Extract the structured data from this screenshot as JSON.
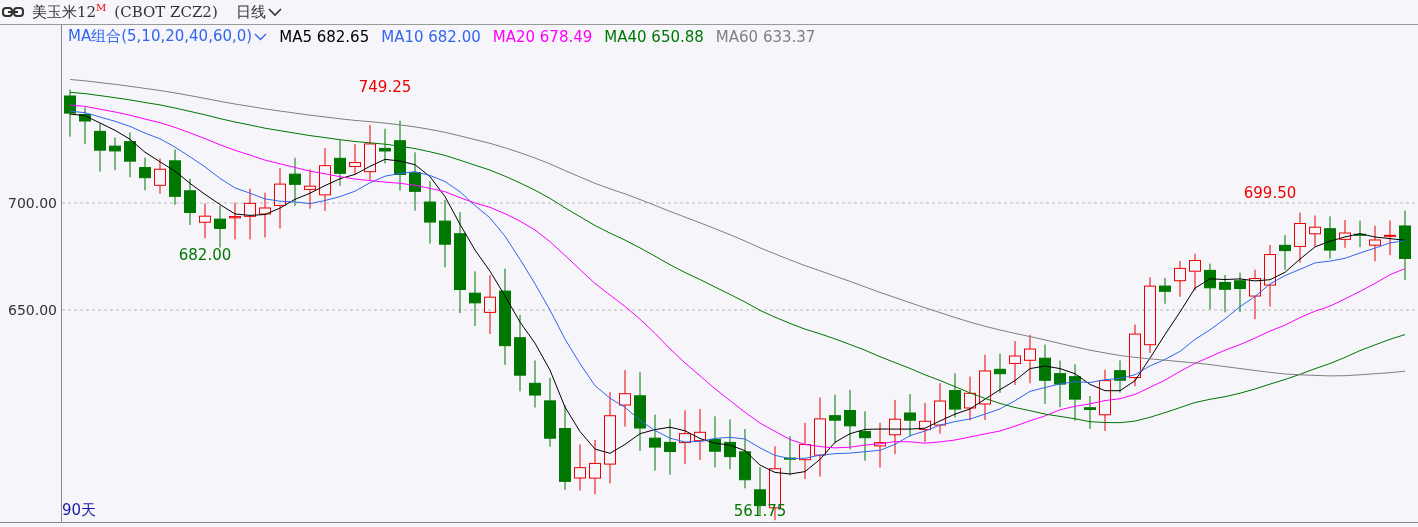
{
  "header": {
    "title": "美玉米12$^{M}$",
    "symbol": "(CBOT ZCZ2)",
    "period": "日线"
  },
  "legend": {
    "group": "MA组合(5,10,20,40,60,0)",
    "items": [
      {
        "label": "MA5 682.65",
        "color": "#000000"
      },
      {
        "label": "MA10 682.00",
        "color": "#3366ee"
      },
      {
        "label": "MA20 678.49",
        "color": "#ff00ff"
      },
      {
        "label": "MA40 650.88",
        "color": "#007700"
      },
      {
        "label": "MA60 633.37",
        "color": "#808080"
      }
    ]
  },
  "y_axis": [
    "700.00",
    "650.00"
  ],
  "annotations": [
    {
      "label": "749.25",
      "kind": "high"
    },
    {
      "label": "682.00",
      "kind": "low"
    },
    {
      "label": "561.75",
      "kind": "low"
    },
    {
      "label": "699.50",
      "kind": "high"
    }
  ],
  "range_label": "90天"
}
